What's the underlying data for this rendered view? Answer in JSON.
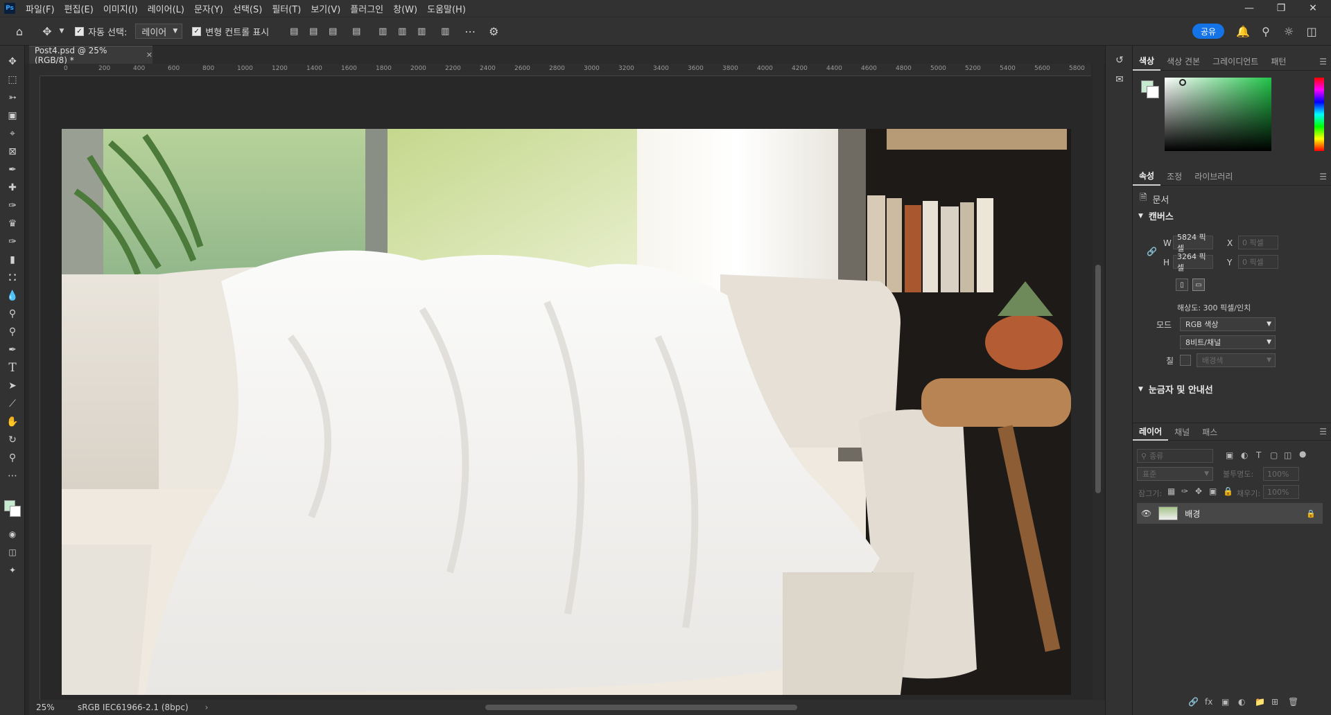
{
  "app": {
    "logo": "Ps"
  },
  "menu": [
    "파일(F)",
    "편집(E)",
    "이미지(I)",
    "레이어(L)",
    "문자(Y)",
    "선택(S)",
    "필터(T)",
    "보기(V)",
    "플러그인",
    "창(W)",
    "도움말(H)"
  ],
  "options": {
    "auto_select_label": "자동 선택:",
    "auto_select_value": "레이어",
    "transform_label": "변형 컨트롤 표시",
    "share_label": "공유"
  },
  "document": {
    "tab_title": "Post4.psd @ 25% (RGB/8) *",
    "ruler_ticks": [
      "0",
      "200",
      "400",
      "600",
      "800",
      "1000",
      "1200",
      "1400",
      "1600",
      "1800",
      "2000",
      "2200",
      "2400",
      "2600",
      "2800",
      "3000",
      "3200",
      "3400",
      "3600",
      "3800",
      "4000",
      "4200",
      "4400",
      "4600",
      "4800",
      "5000",
      "5200",
      "5400",
      "5600",
      "5800"
    ],
    "zoom": "25%",
    "color_profile": "sRGB IEC61966-2.1 (8bpc)"
  },
  "color_panel": {
    "tabs": [
      "색상",
      "색상 견본",
      "그레이디언트",
      "패턴"
    ],
    "foreground": "#c6ead0",
    "background": "#ffffff",
    "hue": "#22c44a"
  },
  "properties_panel": {
    "tabs": [
      "속성",
      "조정",
      "라이브러리"
    ],
    "doc_label": "문서",
    "canvas_header": "캔버스",
    "w_label": "W",
    "w_value": "5824 픽셀",
    "h_label": "H",
    "h_value": "3264 픽셀",
    "x_label": "X",
    "x_placeholder": "0 픽셀",
    "y_label": "Y",
    "y_placeholder": "0 픽셀",
    "resolution": "해상도: 300 픽셀/인치",
    "mode_label": "모드",
    "mode_value": "RGB 색상",
    "bits_value": "8비트/채널",
    "fill_label": "칠",
    "fill_value": "배경색",
    "guides_header": "눈금자 및 안내선"
  },
  "layers_panel": {
    "tabs": [
      "레이어",
      "채널",
      "패스"
    ],
    "filter_placeholder": "종류",
    "blend_mode": "표준",
    "opacity_label": "불투명도:",
    "opacity_value": "100%",
    "lock_label": "잠그기:",
    "fill_label": "채우기:",
    "fill_value": "100%",
    "layers": [
      {
        "name": "배경"
      }
    ]
  }
}
